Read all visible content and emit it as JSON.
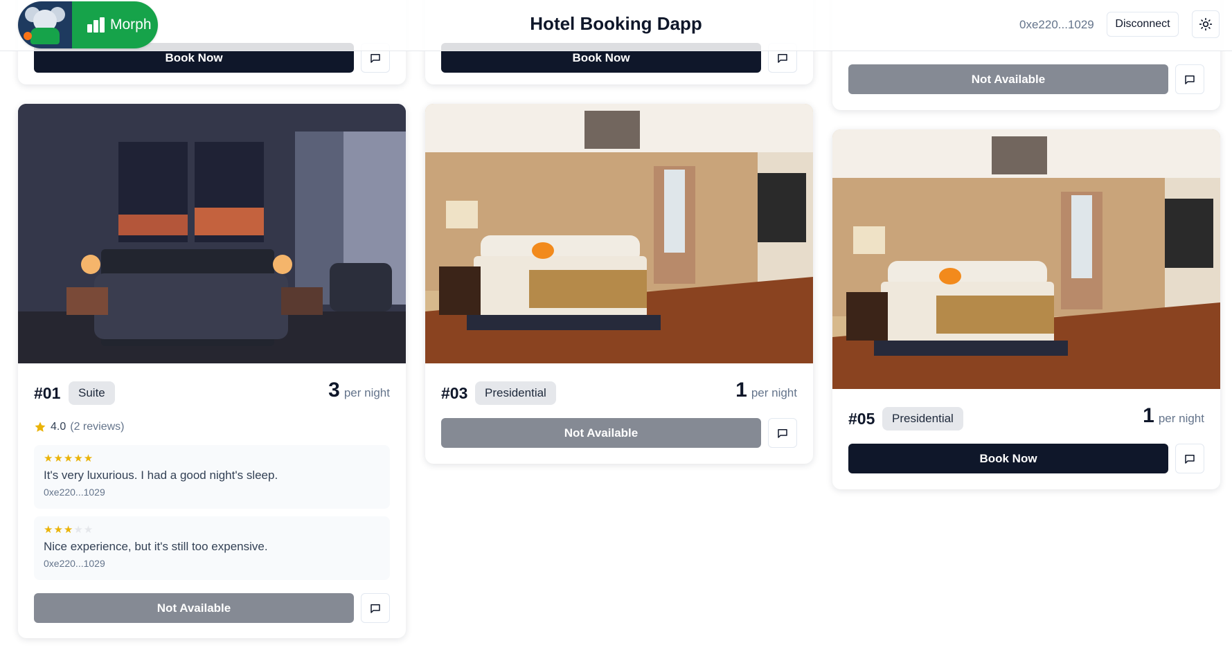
{
  "header": {
    "brand_name": "Morph",
    "title": "Hotel Booking Dapp",
    "wallet_address": "0xe220...1029",
    "disconnect_label": "Disconnect",
    "theme_icon": "sun-icon"
  },
  "top_row": {
    "card1_button": "Book Now",
    "card2_button": "Book Now",
    "card3_button": "Not Available"
  },
  "rooms": [
    {
      "number": "#01",
      "type": "Suite",
      "price": "3",
      "price_unit": "per night",
      "rating": "4.0",
      "reviews_count": "(2 reviews)",
      "reviews": [
        {
          "stars": 5,
          "text": "It's very luxurious. I had a good night's sleep.",
          "author": "0xe220...1029"
        },
        {
          "stars": 3,
          "text": "Nice experience, but it's still too expensive.",
          "author": "0xe220...1029"
        }
      ],
      "button": "Not Available",
      "available": false
    },
    {
      "number": "#03",
      "type": "Presidential",
      "price": "1",
      "price_unit": "per night",
      "button": "Not Available",
      "available": false
    },
    {
      "number": "#05",
      "type": "Presidential",
      "price": "1",
      "price_unit": "per night",
      "button": "Book Now",
      "available": true
    }
  ],
  "colors": {
    "brand_green": "#16a34a",
    "primary_button": "#0f172a",
    "disabled_button": "#858a94",
    "star": "#eab308"
  }
}
